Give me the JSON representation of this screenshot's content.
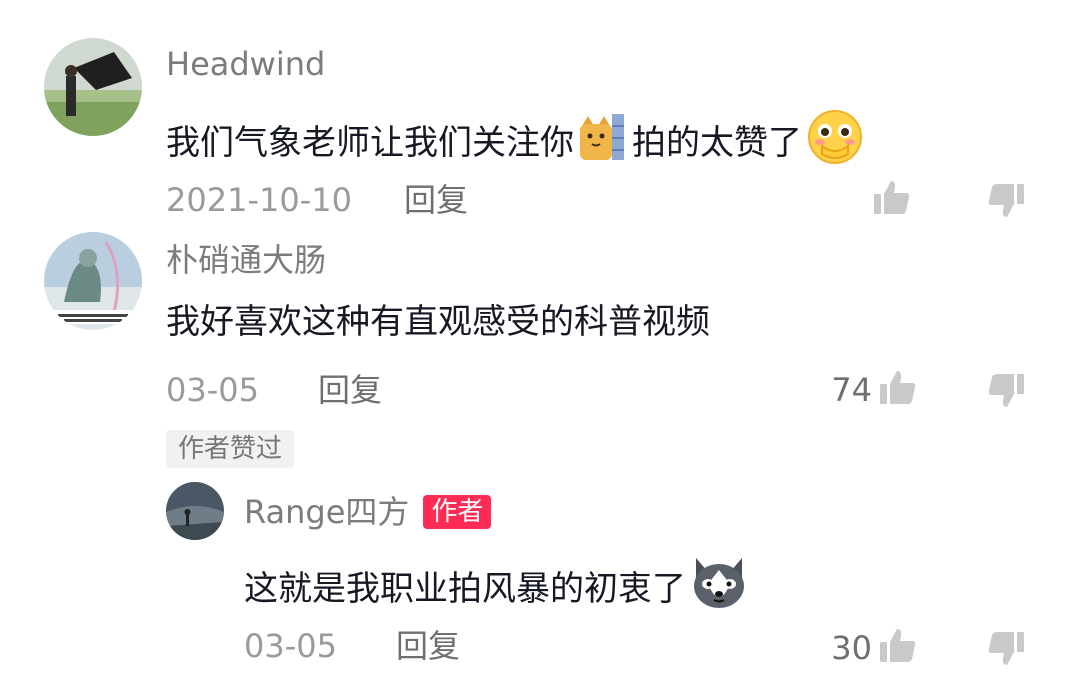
{
  "comments": [
    {
      "username": "Headwind",
      "text_part1": "我们气象老师让我们关注你",
      "text_part2": "拍的太赞了",
      "emoji_inline": "cat-emoji-icon",
      "emoji_end": "blushing-face-emoji-icon",
      "date": "2021-10-10",
      "reply_label": "回复",
      "likes": ""
    },
    {
      "username": "朴硝通大肠",
      "text": "我好喜欢这种有直观感受的科普视频",
      "date": "03-05",
      "reply_label": "回复",
      "likes": "74",
      "liked_badge": "作者赞过"
    }
  ],
  "reply": {
    "username": "Range四方",
    "author_tag": "作者",
    "text": "这就是我职业拍风暴的初衷了",
    "emoji_end": "husky-dog-emoji-icon",
    "date": "03-05",
    "reply_label": "回复",
    "likes": "30"
  },
  "colors": {
    "accent": "#fe2c55",
    "text": "#161823",
    "muted": "#9a9a9e"
  }
}
